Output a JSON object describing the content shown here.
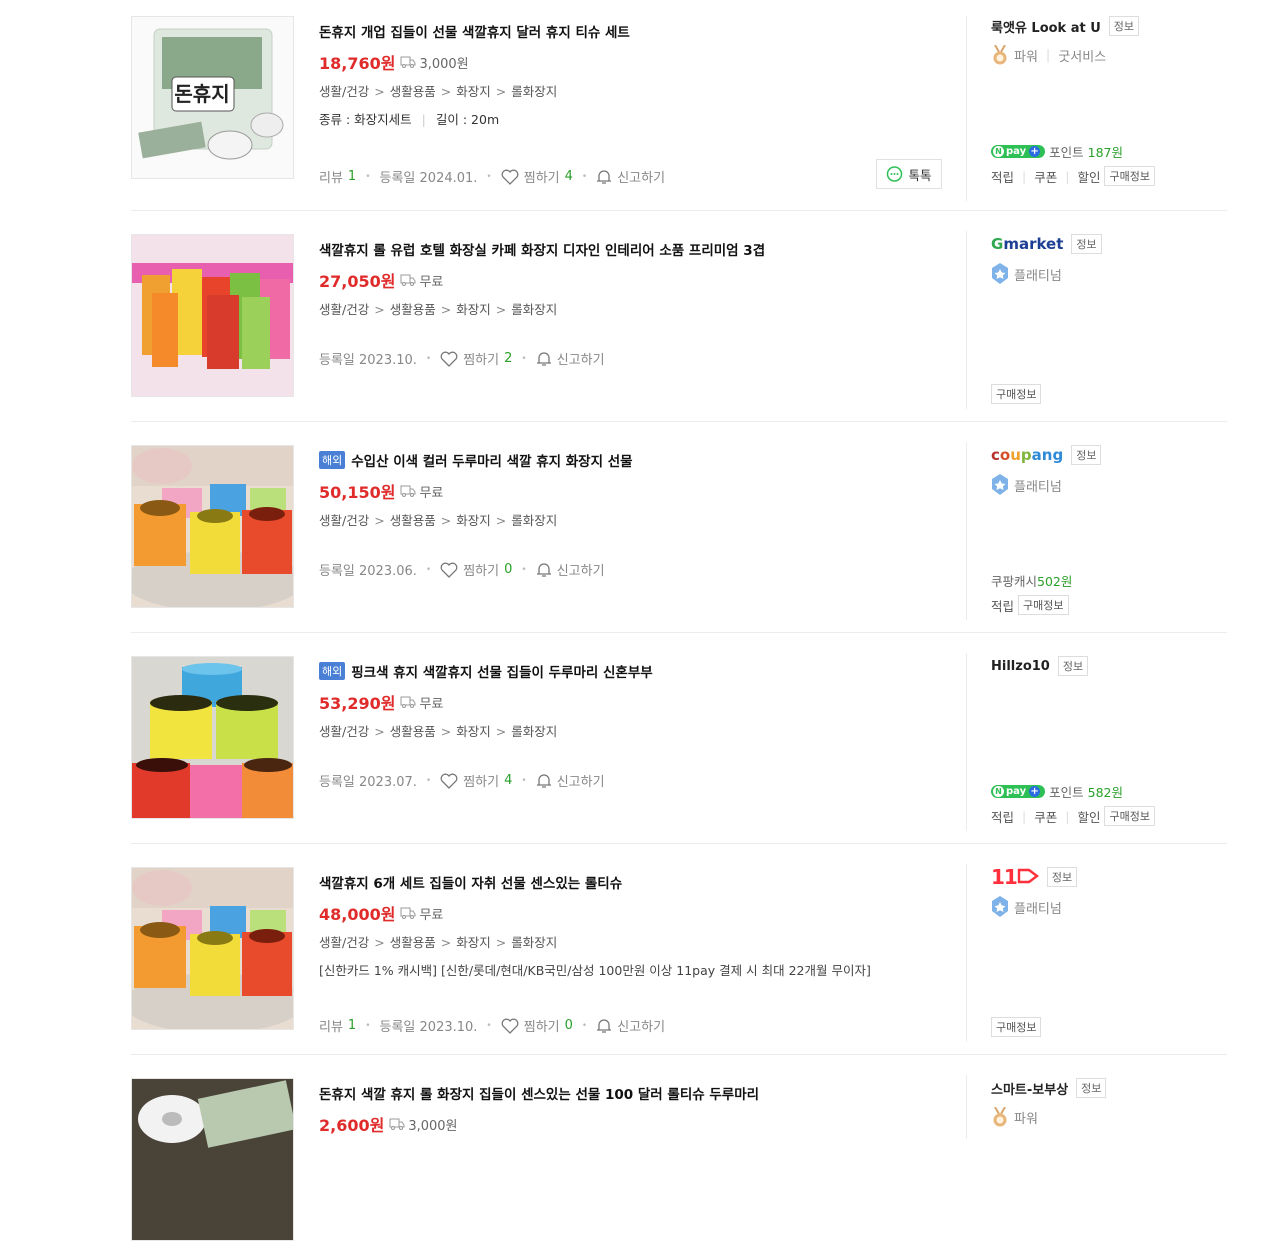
{
  "products": [
    {
      "title": "돈휴지 개업 집들이 선물 색깔휴지 달러 휴지 티슈 세트",
      "overseas": false,
      "price": "18,760원",
      "shipping": "3,000원",
      "categories": [
        "생활/건강",
        "생활용품",
        "화장지",
        "롤화장지"
      ],
      "spec": [
        "종류 : 화장지세트",
        "길이 : 20m"
      ],
      "promo": "",
      "review_label": "리뷰",
      "review_count": "1",
      "registered": "등록일 2024.01.",
      "wish_label": "찜하기",
      "wish_count": "4",
      "report_label": "신고하기",
      "talk_label": "톡톡",
      "seller": {
        "name": "룩앳유 Look at U",
        "info": "정보",
        "grade": "파워",
        "grade2": "굿서비스",
        "points_prefix": "포인트",
        "points_value": "187원",
        "benefits": [
          "적립",
          "쿠폰",
          "할인"
        ],
        "buy_info": "구매정보"
      }
    },
    {
      "title": "색깔휴지 롤 유럽 호텔 화장실 카페 화장지 디자인 인테리어 소품 프리미엄 3겹",
      "overseas": false,
      "price": "27,050원",
      "shipping": "무료",
      "categories": [
        "생활/건강",
        "생활용품",
        "화장지",
        "롤화장지"
      ],
      "registered": "등록일 2023.10.",
      "wish_label": "찜하기",
      "wish_count": "2",
      "report_label": "신고하기",
      "seller": {
        "name": "Gmarket",
        "info": "정보",
        "grade": "플래티넘",
        "buy_info": "구매정보"
      }
    },
    {
      "title": "수입산 이색 컬러 두루마리 색깔 휴지 화장지 선물",
      "overseas": true,
      "overseas_label": "해외",
      "price": "50,150원",
      "shipping": "무료",
      "categories": [
        "생활/건강",
        "생활용품",
        "화장지",
        "롤화장지"
      ],
      "registered": "등록일 2023.06.",
      "wish_label": "찜하기",
      "wish_count": "0",
      "report_label": "신고하기",
      "seller": {
        "name": "coupang",
        "info": "정보",
        "grade": "플래티넘",
        "points_prefix": "쿠팡캐시",
        "points_value": "502원",
        "benefits": [
          "적립"
        ],
        "buy_info": "구매정보"
      }
    },
    {
      "title": "핑크색 휴지 색깔휴지 선물 집들이 두루마리 신혼부부",
      "overseas": true,
      "overseas_label": "해외",
      "price": "53,290원",
      "shipping": "무료",
      "categories": [
        "생활/건강",
        "생활용품",
        "화장지",
        "롤화장지"
      ],
      "registered": "등록일 2023.07.",
      "wish_label": "찜하기",
      "wish_count": "4",
      "report_label": "신고하기",
      "seller": {
        "name": "Hillzo10",
        "info": "정보",
        "points_prefix": "포인트",
        "points_value": "582원",
        "benefits": [
          "적립",
          "쿠폰",
          "할인"
        ],
        "buy_info": "구매정보"
      }
    },
    {
      "title": "색깔휴지 6개 세트 집들이 자취 선물 센스있는 롤티슈",
      "overseas": false,
      "price": "48,000원",
      "shipping": "무료",
      "categories": [
        "생활/건강",
        "생활용품",
        "화장지",
        "롤화장지"
      ],
      "promo": "[신한카드 1% 캐시백] [신한/롯데/현대/KB국민/삼성 100만원 이상 11pay 결제 시 최대 22개월 무이자]",
      "review_label": "리뷰",
      "review_count": "1",
      "registered": "등록일 2023.10.",
      "wish_label": "찜하기",
      "wish_count": "0",
      "report_label": "신고하기",
      "seller": {
        "name": "11번가",
        "info": "정보",
        "grade": "플래티넘",
        "buy_info": "구매정보"
      }
    },
    {
      "title": "돈휴지 색깔 휴지 롤 화장지 집들이 센스있는 선물 100 달러 롤티슈 두루마리",
      "overseas": false,
      "price": "2,600원",
      "shipping": "3,000원",
      "seller": {
        "name": "스마트-보부상",
        "info": "정보",
        "grade": "파워"
      }
    }
  ],
  "colors": {
    "price": "#e02b2b",
    "count": "#2aa02a",
    "npay": "#2ec055",
    "overseas_badge": "#4a7fd6"
  },
  "icons": {
    "shipping": "truck-icon",
    "wish": "heart-icon",
    "report": "bell-icon",
    "talk": "chat-bubble-icon",
    "power": "medal-icon",
    "platinum": "shield-badge-icon"
  }
}
